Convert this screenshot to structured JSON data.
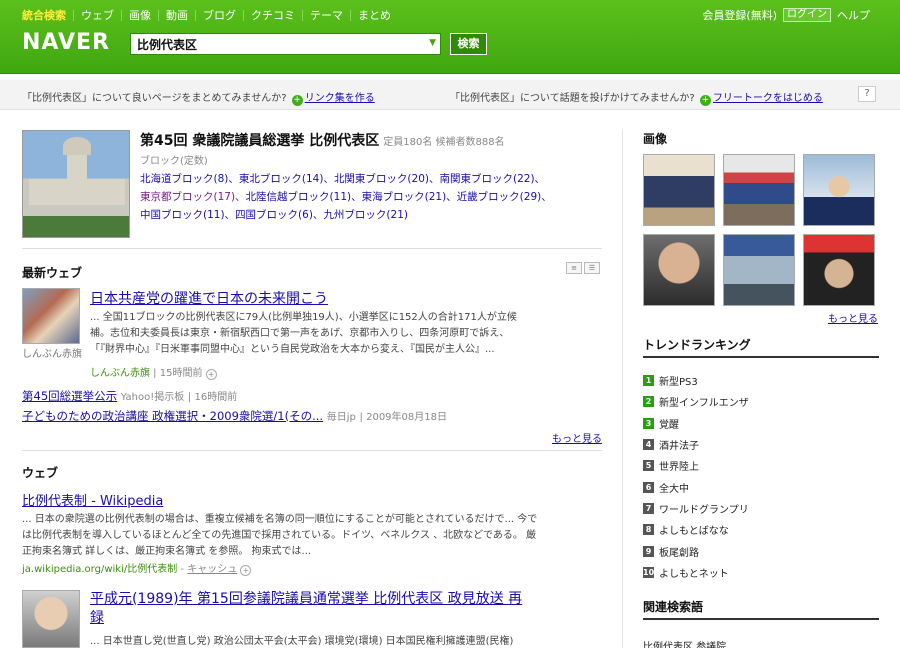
{
  "gnav": [
    "統合検索",
    "ウェブ",
    "画像",
    "動画",
    "ブログ",
    "クチコミ",
    "テーマ",
    "まとめ"
  ],
  "logo": "NAVER",
  "search": {
    "value": "比例代表区",
    "button": "検索"
  },
  "toplinks": {
    "register": "会員登録(無料)",
    "login": "ログイン",
    "help": "ヘルプ"
  },
  "infobar": {
    "left_pre": "「比例代表区」について良いページをまとめてみませんか?",
    "left_link": "リンク集を作る",
    "right_pre": "「比例代表区」について話題を投げかけてみませんか?",
    "right_link": "フリートークをはじめる",
    "help": "?"
  },
  "election": {
    "title": "第45回 衆議院議員総選挙 比例代表区",
    "meta": "定員180名 候補者数888名",
    "sub": "ブロック(定数)",
    "blocks": [
      {
        "text": "北海道ブロック(8)、"
      },
      {
        "text": "東北ブロック(14)、"
      },
      {
        "text": "北関東ブロック(20)、"
      },
      {
        "text": "南関東ブロック(22)、"
      },
      {
        "text": "東京都ブロック(17)、",
        "visited": true
      },
      {
        "text": "北陸信越ブロック(11)、"
      },
      {
        "text": "東海ブロック(21)、"
      },
      {
        "text": "近畿ブロック(29)、"
      },
      {
        "text": "中国ブロック(11)、"
      },
      {
        "text": "四国ブロック(6)、"
      },
      {
        "text": "九州ブロック(21)"
      }
    ]
  },
  "latest_web": {
    "heading": "最新ウェブ",
    "news": {
      "title": "日本共産党の躍進で日本の未来開こう",
      "body1": "... 全国11ブロックの比例代表区に79人(比例単独19人)、小選挙区に152人の合計171人が立候",
      "body2": "補。志位和夫委員長は東京・新宿駅西口で第一声をあげ、京都市入りし、四条河原町で訴え、",
      "body3": "「『財界中心』『日米軍事同盟中心』という自民党政治を大本から変え、『国民が主人公』...",
      "source": "しんぶん赤旗",
      "time": "15時間前",
      "thumb_caption": "しんぶん赤旗"
    },
    "related": [
      {
        "title": "第45回総選挙公示",
        "source": "Yahoo!掲示板",
        "time": "16時間前"
      },
      {
        "title": "子どものための政治講座 政権選択・2009衆院選/1(その...",
        "source": "毎日jp",
        "time": "2009年08月18日"
      }
    ],
    "more": "もっと見る"
  },
  "web": {
    "heading": "ウェブ",
    "r1": {
      "title": "比例代表制 - Wikipedia",
      "body1": "... 日本の衆院選の比例代表制の場合は、重複立候補を名簿の同一順位にすることが可能とされているだけで... 今で",
      "body2": "は比例代表制を導入しているほとんど全ての先進国で採用されている。ドイツ、ベネルクス 、北欧などである。 厳",
      "body3": "正拘束名簿式 詳しくは、厳正拘束名簿式 を参照。 拘束式では...",
      "url": "ja.wikipedia.org/wiki/比例代表制",
      "cache": "キャッシュ"
    },
    "r2": {
      "title": "平成元(1989)年 第15回参議院議員通常選挙 比例代表区 政見放送 再録",
      "body": "... 日本世直し党(世直し党) 政治公団太平会(太平会) 環境党(環境) 日本国民権利擁護連盟(民権)"
    }
  },
  "side": {
    "images_heading": "画像",
    "images_more": "もっと見る",
    "trend_heading": "トレンドランキング",
    "trend": [
      "新型PS3",
      "新型インフルエンザ",
      "覚醒",
      "酒井法子",
      "世界陸上",
      "全大中",
      "ワールドグランプリ",
      "よしもとばなな",
      "板尾創路",
      "よしもとネット"
    ],
    "related_heading": "関連検索語",
    "related_first": "比例代表区 参議院"
  }
}
